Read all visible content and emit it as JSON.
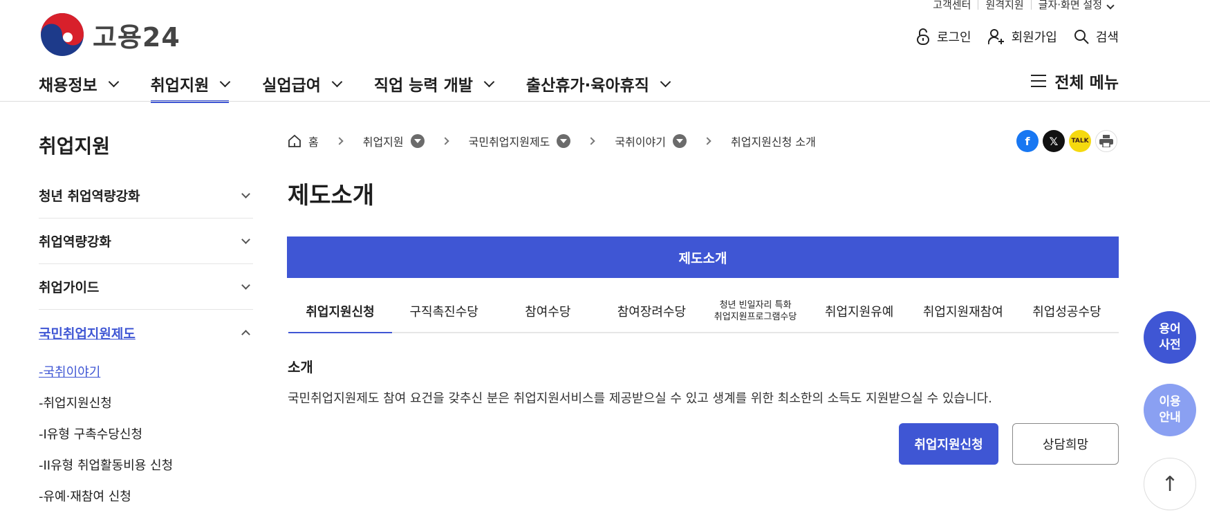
{
  "utility": [
    "고객센터",
    "원격지원",
    "글자·화면 설정"
  ],
  "logo": {
    "text": "고용24"
  },
  "user_actions": [
    {
      "label": "로그인",
      "icon": "lock-icon"
    },
    {
      "label": "회원가입",
      "icon": "add-user-icon"
    },
    {
      "label": "검색",
      "icon": "search-icon"
    }
  ],
  "gnb": [
    {
      "label": "채용정보"
    },
    {
      "label": "취업지원",
      "active": true
    },
    {
      "label": "실업급여"
    },
    {
      "label": "직업 능력 개발"
    },
    {
      "label": "출산휴가·육아휴직"
    }
  ],
  "all_menu": "전체 메뉴",
  "sidebar": {
    "title": "취업지원",
    "items": [
      {
        "label": "청년 취업역량강화"
      },
      {
        "label": "취업역량강화"
      },
      {
        "label": "취업가이드"
      },
      {
        "label": "국민취업지원제도",
        "open": true
      }
    ],
    "sub_items": [
      "-국취이야기",
      "-취업지원신청",
      "-I유형 구촉수당신청",
      "-II유형 취업활동비용 신청",
      "-유예·재참여 신청"
    ]
  },
  "breadcrumb": {
    "home": "홈",
    "items": [
      "취업지원",
      "국민취업지원제도",
      "국취이야기",
      "취업지원신청 소개"
    ]
  },
  "share": [
    "facebook-icon",
    "x-icon",
    "kakaotalk-icon",
    "print-icon"
  ],
  "page_title": "제도소개",
  "banner": "제도소개",
  "tabs": [
    {
      "label": "취업지원신청",
      "active": true
    },
    {
      "label": "구직촉진수당"
    },
    {
      "label": "참여수당"
    },
    {
      "label": "참여장려수당"
    },
    {
      "label_line1": "청년 빈일자리 특화",
      "label_line2": "취업지원프로그램수당"
    },
    {
      "label": "취업지원유예"
    },
    {
      "label": "취업지원재참여"
    },
    {
      "label": "취업성공수당"
    }
  ],
  "section": {
    "title": "소개",
    "text": "국민취업지원제도 참여 요건을 갖추신 분은 취업지원서비스를 제공받으실 수 있고 생계를 위한 최소한의 소득도 지원받으실 수 있습니다."
  },
  "buttons": {
    "apply": "취업지원신청",
    "consult": "상담희망"
  },
  "floating": {
    "dict_line1": "용어",
    "dict_line2": "사전",
    "guide_line1": "이용",
    "guide_line2": "안내",
    "top": "↑"
  },
  "colors": {
    "accent": "#3f56d4",
    "accent_light": "#8aa0f2"
  }
}
